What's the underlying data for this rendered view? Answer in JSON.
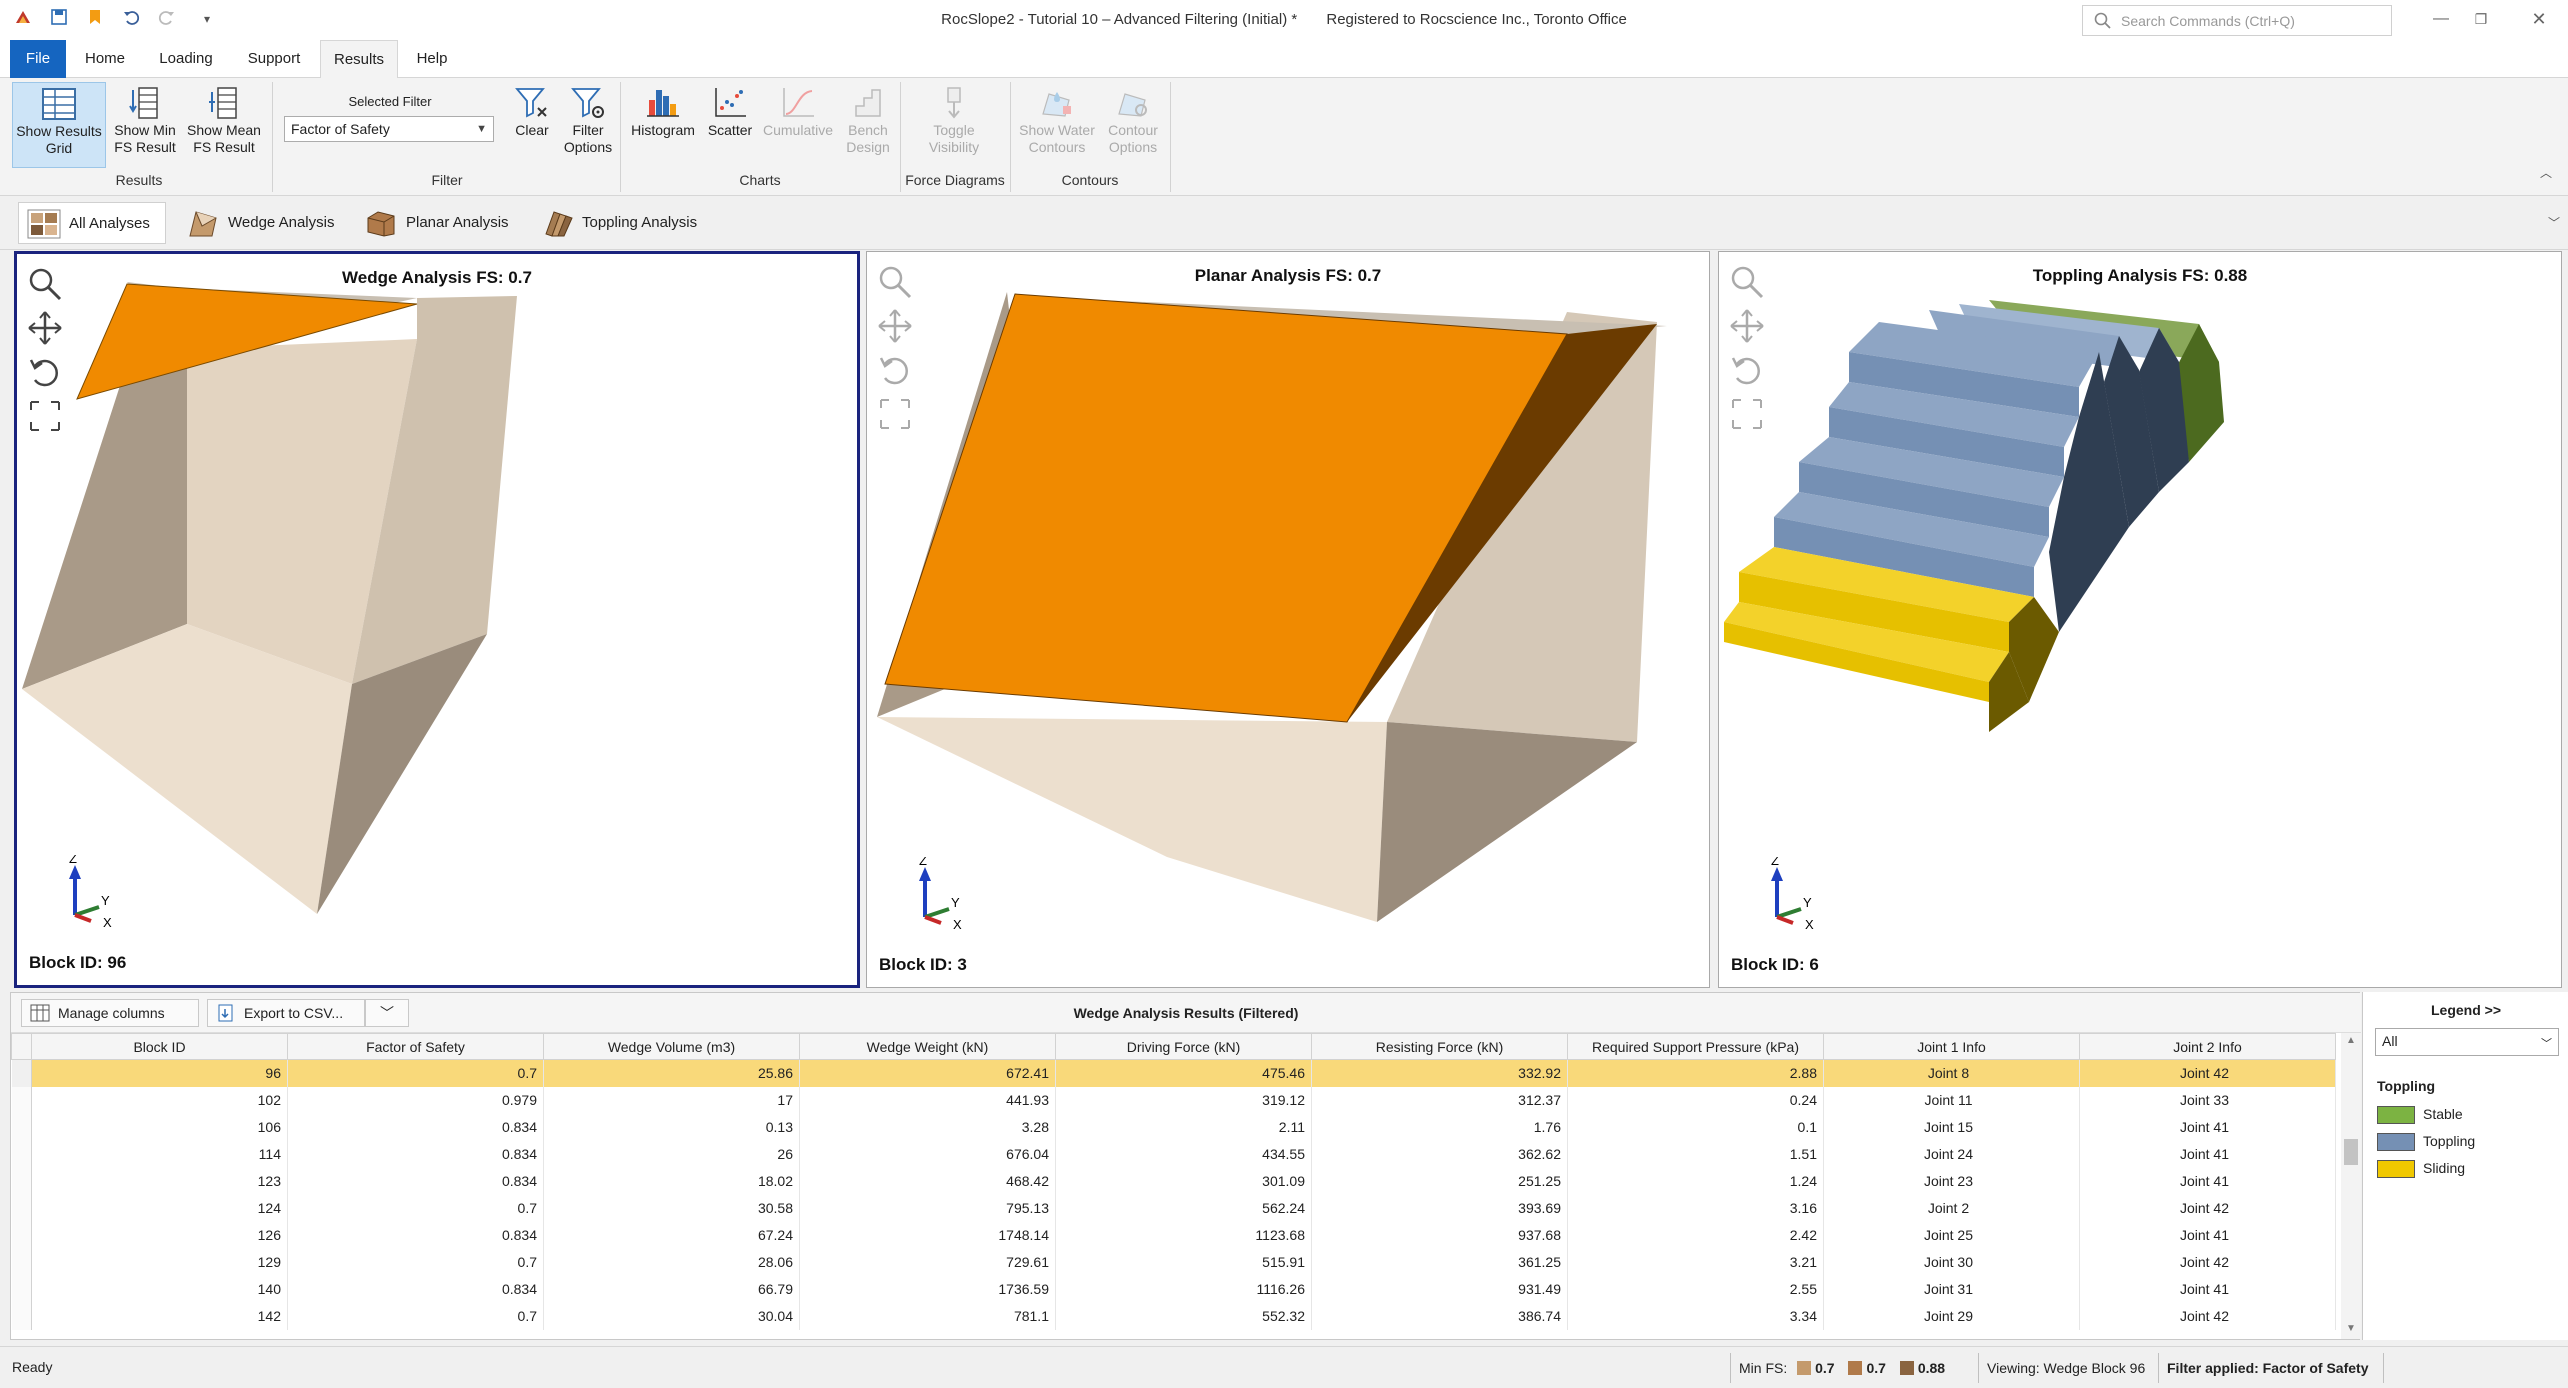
{
  "app": {
    "title": "RocSlope2 - Tutorial 10 – Advanced Filtering (Initial) *",
    "registration": "Registered to Rocscience Inc., Toronto Office",
    "search_placeholder": "Search Commands (Ctrl+Q)"
  },
  "menu": {
    "tabs": [
      "File",
      "Home",
      "Loading",
      "Support",
      "Results",
      "Help"
    ],
    "active": "Results"
  },
  "ribbon": {
    "results_group": {
      "label": "Results",
      "buttons": [
        {
          "line1": "Show Results",
          "line2": "Grid",
          "icon": "grid-icon",
          "selected": true
        },
        {
          "line1": "Show Min",
          "line2": "FS Result",
          "icon": "min-fs-icon"
        },
        {
          "line1": "Show Mean",
          "line2": "FS Result",
          "icon": "mean-fs-icon"
        }
      ]
    },
    "filter_group": {
      "label": "Filter",
      "selected_filter_label": "Selected Filter",
      "selected_filter_value": "Factor of Safety",
      "clear_label": "Clear",
      "options_line1": "Filter",
      "options_line2": "Options"
    },
    "charts_group": {
      "label": "Charts",
      "histogram": "Histogram",
      "scatter": "Scatter",
      "cumulative": "Cumulative",
      "bench_line1": "Bench",
      "bench_line2": "Design"
    },
    "force_group": {
      "label": "Force Diagrams",
      "line1": "Toggle",
      "line2": "Visibility"
    },
    "contours_group": {
      "label": "Contours",
      "water_line1": "Show Water",
      "water_line2": "Contours",
      "options_line1": "Contour",
      "options_line2": "Options"
    }
  },
  "analysis_tabs": [
    "All Analyses",
    "Wedge Analysis",
    "Planar Analysis",
    "Toppling Analysis"
  ],
  "views": {
    "wedge": {
      "title": "Wedge Analysis FS: 0.7",
      "block_id": "Block ID: 96"
    },
    "planar": {
      "title": "Planar Analysis FS: 0.7",
      "block_id": "Block ID: 3"
    },
    "toppling": {
      "title": "Toppling Analysis FS: 0.88",
      "block_id": "Block ID: 6"
    },
    "axis_labels": {
      "z": "Z",
      "y": "Y",
      "x": "X"
    }
  },
  "results": {
    "manage_columns": "Manage columns",
    "export": "Export to CSV...",
    "title": "Wedge Analysis Results (Filtered)",
    "columns": [
      "Block ID",
      "Factor of Safety",
      "Wedge Volume (m3)",
      "Wedge Weight (kN)",
      "Driving Force (kN)",
      "Resisting Force (kN)",
      "Required Support Pressure (kPa)",
      "Joint 1 Info",
      "Joint 2 Info"
    ],
    "rows": [
      [
        "96",
        "0.7",
        "25.86",
        "672.41",
        "475.46",
        "332.92",
        "2.88",
        "Joint 8",
        "Joint 42"
      ],
      [
        "102",
        "0.979",
        "17",
        "441.93",
        "319.12",
        "312.37",
        "0.24",
        "Joint 11",
        "Joint 33"
      ],
      [
        "106",
        "0.834",
        "0.13",
        "3.28",
        "2.11",
        "1.76",
        "0.1",
        "Joint 15",
        "Joint 41"
      ],
      [
        "114",
        "0.834",
        "26",
        "676.04",
        "434.55",
        "362.62",
        "1.51",
        "Joint 24",
        "Joint 41"
      ],
      [
        "123",
        "0.834",
        "18.02",
        "468.42",
        "301.09",
        "251.25",
        "1.24",
        "Joint 23",
        "Joint 41"
      ],
      [
        "124",
        "0.7",
        "30.58",
        "795.13",
        "562.24",
        "393.69",
        "3.16",
        "Joint 2",
        "Joint 42"
      ],
      [
        "126",
        "0.834",
        "67.24",
        "1748.14",
        "1123.68",
        "937.68",
        "2.42",
        "Joint 25",
        "Joint 41"
      ],
      [
        "129",
        "0.7",
        "28.06",
        "729.61",
        "515.91",
        "361.25",
        "3.21",
        "Joint 30",
        "Joint 42"
      ],
      [
        "140",
        "0.834",
        "66.79",
        "1736.59",
        "1116.26",
        "931.49",
        "2.55",
        "Joint 31",
        "Joint 41"
      ],
      [
        "142",
        "0.7",
        "30.04",
        "781.1",
        "552.32",
        "386.74",
        "3.34",
        "Joint 29",
        "Joint 42"
      ]
    ],
    "selected_row": 0
  },
  "legend": {
    "header": "Legend >>",
    "select_value": "All",
    "category": "Toppling",
    "items": [
      {
        "label": "Stable",
        "color": "#7cb342"
      },
      {
        "label": "Toppling",
        "color": "#7590b4"
      },
      {
        "label": "Sliding",
        "color": "#f0c800"
      }
    ]
  },
  "status": {
    "ready": "Ready",
    "min_fs_label": "Min FS:",
    "wedge_fs": "0.7",
    "planar_fs": "0.7",
    "toppling_fs": "0.88",
    "viewing": "Viewing: Wedge Block 96",
    "filter_applied": "Filter applied: Factor of Safety"
  },
  "colors": {
    "accent": "#1565c0",
    "selection": "#f9d97a",
    "active_view_border": "#1a237e",
    "block_orange": "#f08a00",
    "rock_face": "#e9dccb"
  }
}
